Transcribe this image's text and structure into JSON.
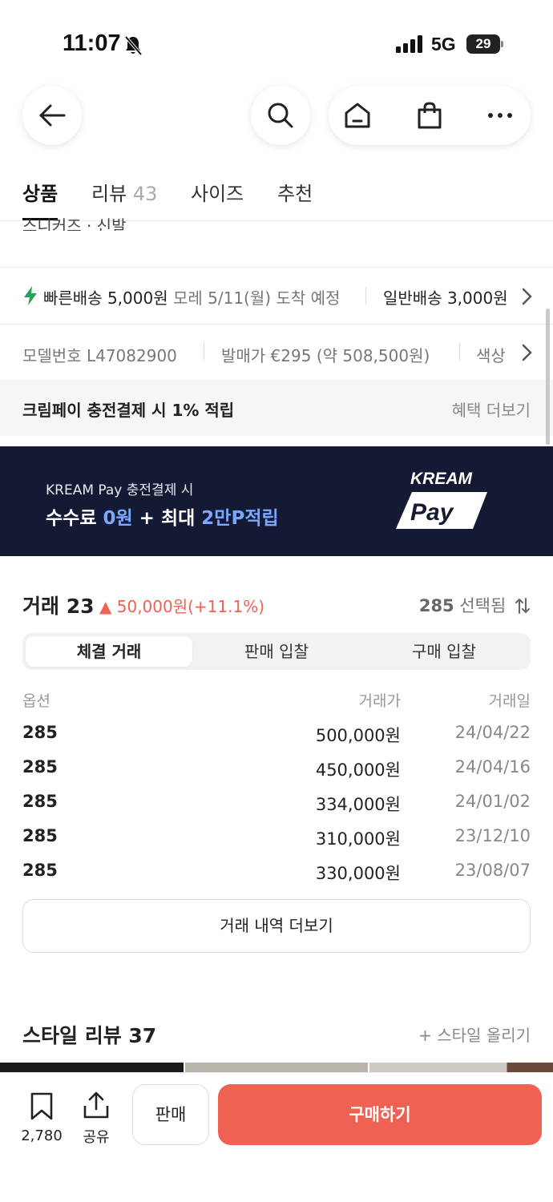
{
  "status_bar": {
    "time": "11:07",
    "network": "5G",
    "battery": "29"
  },
  "nav": {
    "icons": [
      "back-arrow-icon",
      "search-icon",
      "home-icon",
      "shopping-bag-icon",
      "more-icon"
    ]
  },
  "tabs": [
    {
      "label": "상품",
      "count": ""
    },
    {
      "label": "리뷰",
      "count": "43"
    },
    {
      "label": "사이즈",
      "count": ""
    },
    {
      "label": "추천",
      "count": ""
    }
  ],
  "breadcrumb": "스니커즈 · 신발",
  "shipping": {
    "fast_label": "빠른배송 5,000원",
    "fast_eta": "모레 5/11(월) 도착 예정",
    "normal_label": "일반배송 3,000원"
  },
  "model": {
    "model_no": "모델번호 L47082900",
    "release_price": "발매가 €295 (약 508,500원)",
    "color": "색상"
  },
  "benefit": {
    "label": "크림페이 충전결제 시 1% 적립",
    "link": "혜택 더보기"
  },
  "banner": {
    "line1": "KREAM Pay 충전결제 시",
    "line2_a": "수수료 ",
    "line2_b": "0원",
    "line2_c": " + 최대 ",
    "line2_d": "2만P적립",
    "logo_top": "KREAM",
    "logo_bottom": "Pay",
    "bg_color": "#141a33"
  },
  "trade": {
    "title": "거래 23",
    "delta": "▲ 50,000원(+11.1%)",
    "size_value": "285",
    "size_suffix": " 선택됨",
    "segments": [
      "체결 거래",
      "판매 입찰",
      "구매 입찰"
    ],
    "headers": [
      "옵션",
      "거래가",
      "거래일"
    ],
    "rows": [
      {
        "option": "285",
        "price": "500,000원",
        "date": "24/04/22"
      },
      {
        "option": "285",
        "price": "450,000원",
        "date": "24/04/16"
      },
      {
        "option": "285",
        "price": "334,000원",
        "date": "24/01/02"
      },
      {
        "option": "285",
        "price": "310,000원",
        "date": "23/12/10"
      },
      {
        "option": "285",
        "price": "330,000원",
        "date": "23/08/07"
      }
    ],
    "more_button": "거래 내역 더보기"
  },
  "style_review": {
    "title": "스타일 리뷰 37",
    "upload": "+ 스타일 올리기"
  },
  "bottom_bar": {
    "bookmark_count": "2,780",
    "share_label": "공유",
    "sell_label": "판매",
    "buy_label": "구매하기",
    "buy_color": "#ef6253"
  }
}
